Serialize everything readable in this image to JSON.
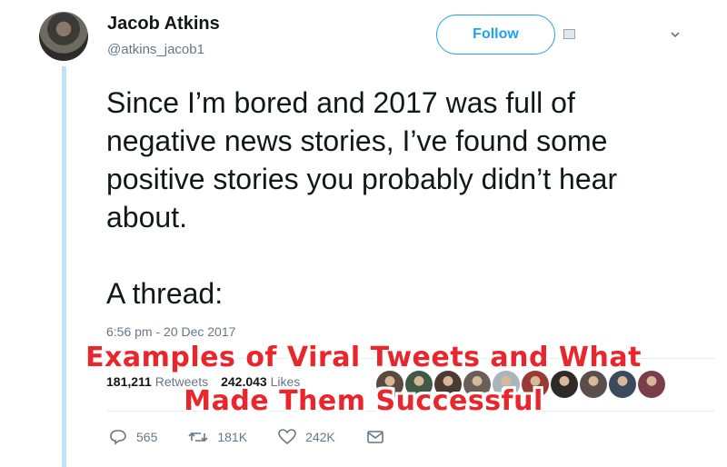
{
  "author": {
    "name": "Jacob Atkins",
    "handle": "@atkins_jacob1"
  },
  "follow_label": "Follow",
  "tweet": {
    "text": "Since I’m bored and 2017 was full of\nnegative news stories, I’ve found some\npositive stories you probably didn’t hear\nabout.\n\nA thread:",
    "timestamp": "6:56 pm - 20 Dec 2017"
  },
  "stats": {
    "retweets_count": "181,211",
    "retweets_label": "Retweets",
    "likes_count": "242,043",
    "likes_label": "Likes"
  },
  "liker_avatars": [
    "#5b4a3f",
    "#3f5a45",
    "#4b3b33",
    "#6a5e58",
    "#a9b4bd",
    "#9a3a34",
    "#2f2a28",
    "#5a4f4a",
    "#3c4a5e",
    "#7a3d4a"
  ],
  "overlay": {
    "line1": "Examples of Viral Tweets and What",
    "line2": "Made Them Successful"
  },
  "actions": {
    "reply_count": "565",
    "retweet_count": "181K",
    "like_count": "242K"
  },
  "colors": {
    "accent": "#1da1f2",
    "thread_line": "#c2e2f5",
    "overlay_text": "#e8262b",
    "muted": "#657786"
  },
  "icons": [
    "avatar",
    "badge-icon",
    "chevron-down-icon",
    "reply-icon",
    "retweet-icon",
    "like-icon",
    "message-icon"
  ]
}
